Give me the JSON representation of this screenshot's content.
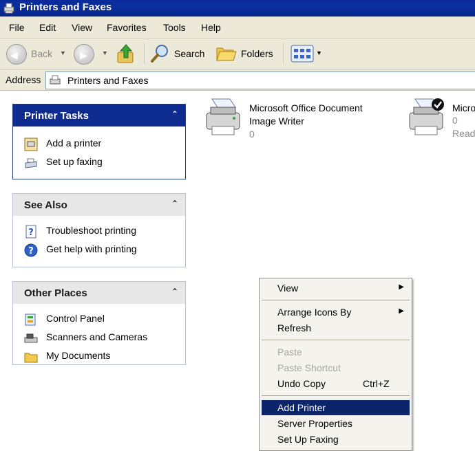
{
  "window": {
    "title": "Printers and Faxes"
  },
  "menubar": [
    "File",
    "Edit",
    "View",
    "Favorites",
    "Tools",
    "Help"
  ],
  "toolbar": {
    "back": "Back",
    "search": "Search",
    "folders": "Folders"
  },
  "address": {
    "label": "Address",
    "value": "Printers and Faxes"
  },
  "panels": {
    "printer_tasks": {
      "title": "Printer Tasks",
      "items": [
        {
          "label": "Add a printer",
          "icon": "add-printer-icon"
        },
        {
          "label": "Set up faxing",
          "icon": "fax-icon"
        }
      ]
    },
    "see_also": {
      "title": "See Also",
      "items": [
        {
          "label": "Troubleshoot printing",
          "icon": "help-page-icon"
        },
        {
          "label": "Get help with printing",
          "icon": "help-circle-icon"
        }
      ]
    },
    "other_places": {
      "title": "Other Places",
      "items": [
        {
          "label": "Control Panel",
          "icon": "control-panel-icon"
        },
        {
          "label": "Scanners and Cameras",
          "icon": "scanner-icon"
        },
        {
          "label": "My Documents",
          "icon": "folder-icon"
        }
      ]
    }
  },
  "printers": [
    {
      "line1": "Microsoft Office Document",
      "line2": "Image Writer",
      "jobs": "0",
      "status": ""
    },
    {
      "line1": "Micro",
      "line2": "",
      "jobs": "0",
      "status": "Read",
      "default": true
    }
  ],
  "context_menu": {
    "items": [
      {
        "label": "View",
        "submenu": true
      },
      {
        "label": "Arrange Icons By",
        "submenu": true
      },
      {
        "label": "Refresh"
      },
      {
        "label": "Paste",
        "disabled": true
      },
      {
        "label": "Paste Shortcut",
        "disabled": true
      },
      {
        "label": "Undo Copy",
        "shortcut": "Ctrl+Z"
      },
      {
        "label": "Add Printer",
        "highlighted": true
      },
      {
        "label": "Server Properties"
      },
      {
        "label": "Set Up Faxing"
      }
    ]
  },
  "colors": {
    "title_bar": "#0b2f9f",
    "panel_header": "#0e2b8f",
    "menu_highlight": "#0b246a",
    "chrome": "#ece9d8"
  }
}
